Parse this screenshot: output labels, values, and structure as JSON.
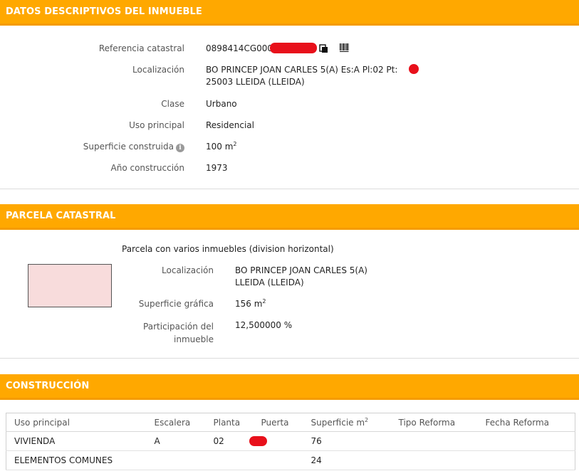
{
  "sections": {
    "descriptivos": {
      "title": "DATOS DESCRIPTIVOS DEL INMUEBLE",
      "referencia_label": "Referencia catastral",
      "referencia_value": "0898414CG000",
      "localizacion_label": "Localización",
      "localizacion_line1": "BO PRINCEP JOAN CARLES 5(A) Es:A Pl:02 Pt:",
      "localizacion_line2": "25003 LLEIDA (LLEIDA)",
      "clase_label": "Clase",
      "clase_value": "Urbano",
      "uso_label": "Uso principal",
      "uso_value": "Residencial",
      "superficie_label": "Superficie construida",
      "superficie_value": "100 m",
      "superficie_unit_sup": "2",
      "anio_label": "Año construcción",
      "anio_value": "1973"
    },
    "parcela": {
      "title": "PARCELA CATASTRAL",
      "subtitle": "Parcela con varios inmuebles (division horizontal)",
      "localizacion_label": "Localización",
      "localizacion_line1": "BO PRINCEP JOAN CARLES 5(A)",
      "localizacion_line2": "LLEIDA (LLEIDA)",
      "superficie_label": "Superficie gráfica",
      "superficie_value": "156 m",
      "superficie_unit_sup": "2",
      "participacion_label_1": "Participación del",
      "participacion_label_2": "inmueble",
      "participacion_value": "12,500000 %"
    },
    "construccion": {
      "title": "CONSTRUCCIÓN",
      "columns": [
        "Uso principal",
        "Escalera",
        "Planta",
        "Puerta",
        "Superficie m",
        "Tipo Reforma",
        "Fecha Reforma"
      ],
      "superficie_col_sup": "2",
      "rows": [
        {
          "uso": "VIVIENDA",
          "escalera": "A",
          "planta": "02",
          "puerta": "",
          "superficie": "76",
          "tipo": "",
          "fecha": ""
        },
        {
          "uso": "ELEMENTOS COMUNES",
          "escalera": "",
          "planta": "",
          "puerta": "",
          "superficie": "24",
          "tipo": "",
          "fecha": ""
        }
      ]
    }
  },
  "icons": {
    "copy": "copy-icon",
    "barcode": "barcode-icon",
    "info": "info-icon"
  },
  "colors": {
    "header_bg": "#ffa800",
    "redaction": "#e8101b",
    "thumbnail_fill": "#f8dcdc"
  }
}
